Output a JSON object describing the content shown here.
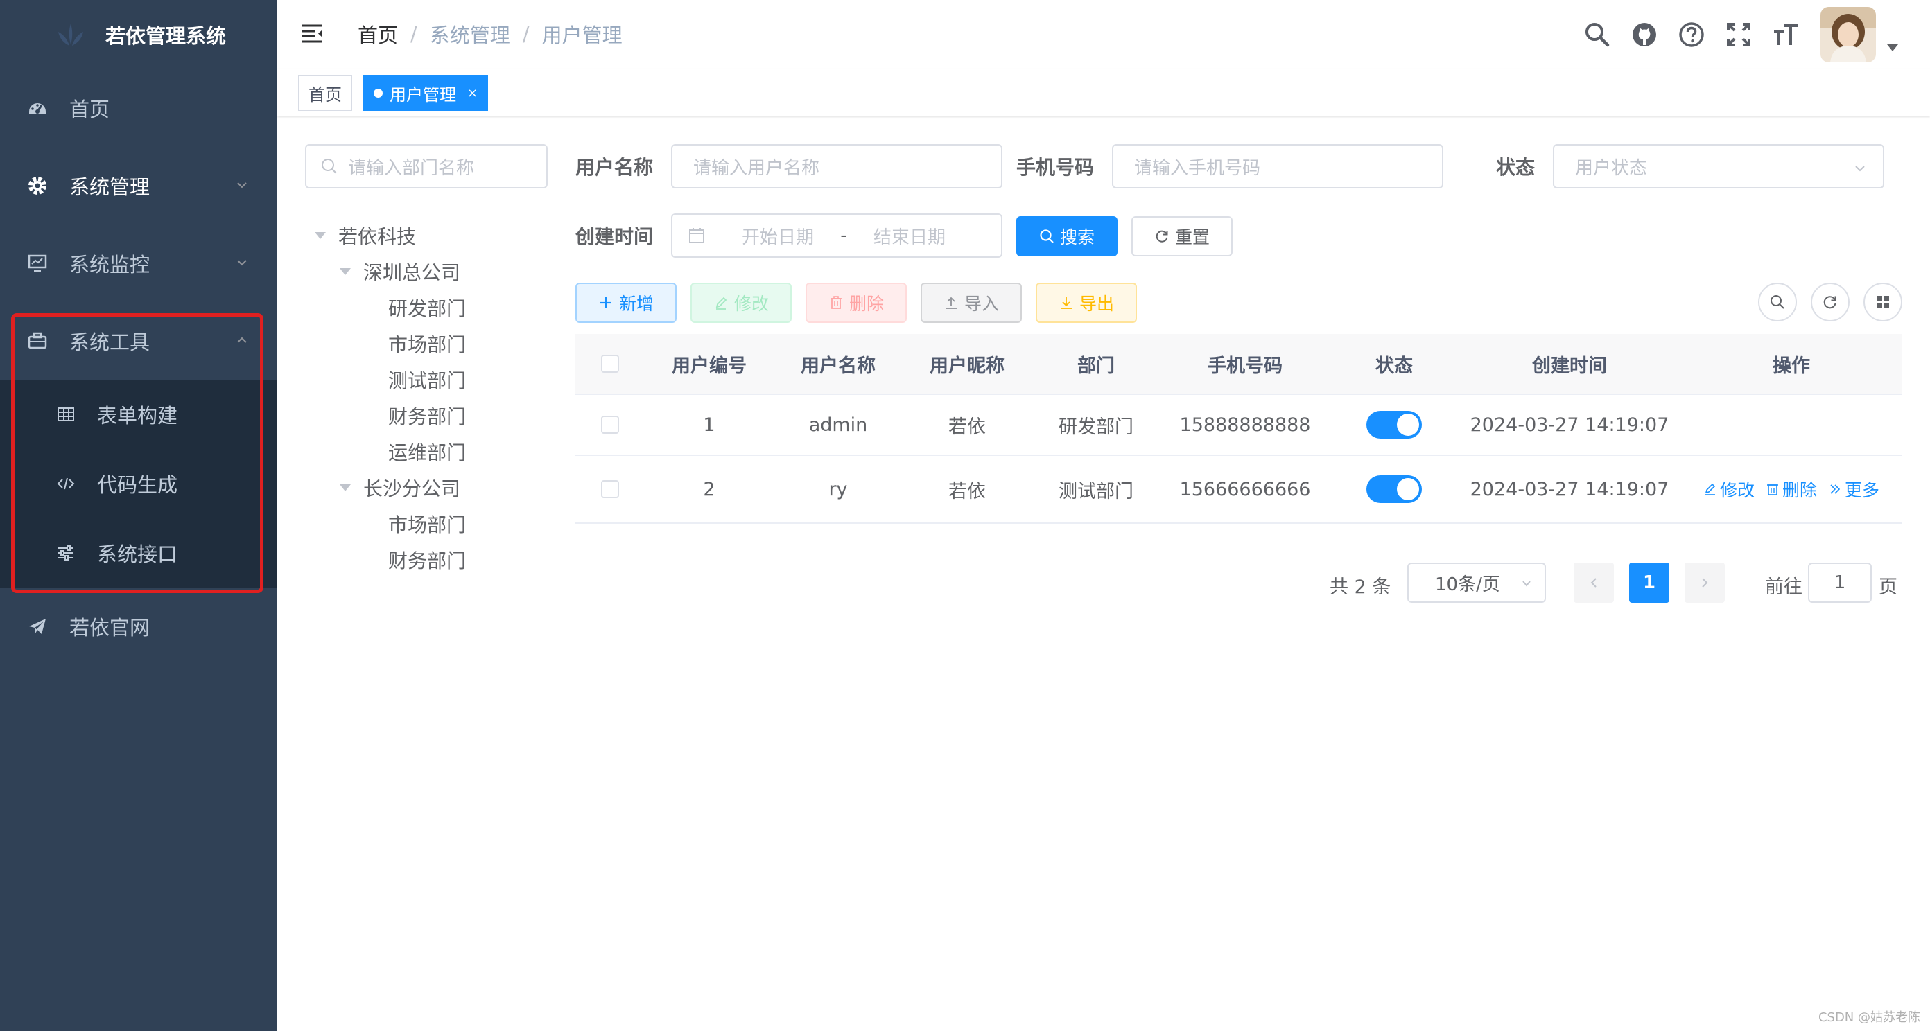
{
  "app": {
    "title": "若依管理系统"
  },
  "sidebar": {
    "items": [
      {
        "label": "首页",
        "icon": "dashboard-icon"
      },
      {
        "label": "系统管理",
        "icon": "gear-icon"
      },
      {
        "label": "系统监控",
        "icon": "monitor-icon"
      },
      {
        "label": "系统工具",
        "icon": "toolbox-icon",
        "expanded": true
      },
      {
        "label": "若依官网",
        "icon": "paper-plane-icon"
      }
    ],
    "tool_submenu": [
      {
        "label": "表单构建",
        "icon": "table-icon"
      },
      {
        "label": "代码生成",
        "icon": "code-icon"
      },
      {
        "label": "系统接口",
        "icon": "sliders-icon"
      }
    ]
  },
  "breadcrumb": [
    "首页",
    "系统管理",
    "用户管理"
  ],
  "tags": [
    {
      "label": "首页",
      "active": false
    },
    {
      "label": "用户管理",
      "active": true,
      "close": "×"
    }
  ],
  "dept_tree": {
    "search_placeholder": "请输入部门名称",
    "nodes": [
      {
        "label": "若依科技",
        "level": 0,
        "expanded": true
      },
      {
        "label": "深圳总公司",
        "level": 1,
        "expanded": true
      },
      {
        "label": "研发部门",
        "level": 2
      },
      {
        "label": "市场部门",
        "level": 2
      },
      {
        "label": "测试部门",
        "level": 2
      },
      {
        "label": "财务部门",
        "level": 2
      },
      {
        "label": "运维部门",
        "level": 2
      },
      {
        "label": "长沙分公司",
        "level": 1,
        "expanded": true
      },
      {
        "label": "市场部门",
        "level": 2
      },
      {
        "label": "财务部门",
        "level": 2
      }
    ]
  },
  "search_form": {
    "username_label": "用户名称",
    "username_placeholder": "请输入用户名称",
    "phone_label": "手机号码",
    "phone_placeholder": "请输入手机号码",
    "status_label": "状态",
    "status_placeholder": "用户状态",
    "created_label": "创建时间",
    "start_placeholder": "开始日期",
    "range_sep": "-",
    "end_placeholder": "结束日期",
    "search_button": "搜索",
    "reset_button": "重置"
  },
  "toolbar": {
    "add": "新增",
    "edit": "修改",
    "delete": "删除",
    "import": "导入",
    "export": "导出"
  },
  "table": {
    "columns": [
      "用户编号",
      "用户名称",
      "用户昵称",
      "部门",
      "手机号码",
      "状态",
      "创建时间",
      "操作"
    ],
    "rows": [
      {
        "id": "1",
        "username": "admin",
        "nickname": "若依",
        "dept": "研发部门",
        "phone": "15888888888",
        "status_on": true,
        "created": "2024-03-27 14:19:07",
        "actions": []
      },
      {
        "id": "2",
        "username": "ry",
        "nickname": "若依",
        "dept": "测试部门",
        "phone": "15666666666",
        "status_on": true,
        "created": "2024-03-27 14:19:07",
        "actions": [
          "修改",
          "删除",
          "更多"
        ]
      }
    ]
  },
  "pagination": {
    "total": "共 2 条",
    "page_size": "10条/页",
    "current_page": "1",
    "jump_prefix": "前往",
    "jump_value": "1",
    "jump_suffix": "页"
  },
  "colors": {
    "sidebar_bg": "#304156",
    "submenu_bg": "#1f2d3d",
    "primary": "#1890ff",
    "highlight": "#e02020"
  },
  "watermark": "CSDN @姑苏老陈"
}
